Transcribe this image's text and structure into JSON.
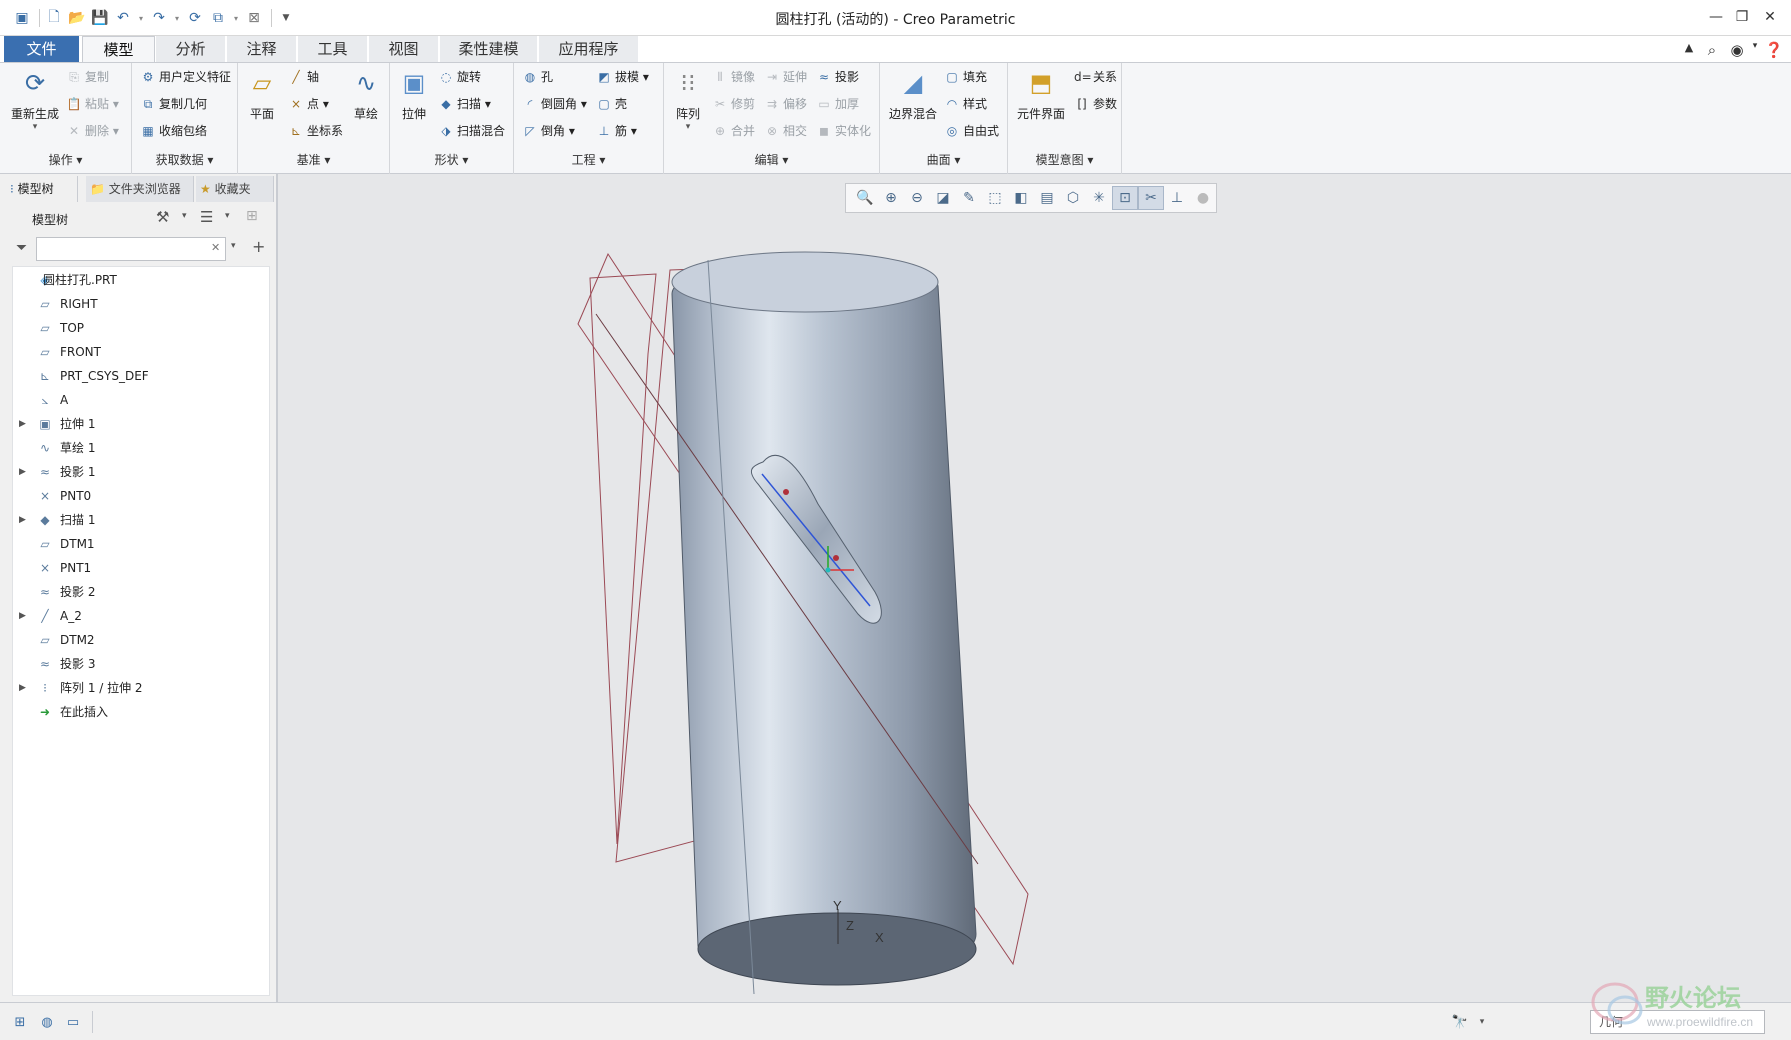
{
  "window": {
    "title": "圆柱打孔 (活动的) - Creo Parametric"
  },
  "tabs": [
    {
      "label": "文件"
    },
    {
      "label": "模型"
    },
    {
      "label": "分析"
    },
    {
      "label": "注释"
    },
    {
      "label": "工具"
    },
    {
      "label": "视图"
    },
    {
      "label": "柔性建模"
    },
    {
      "label": "应用程序"
    }
  ],
  "ribbon": {
    "operations": {
      "regen": "重新生成",
      "copy": "复制",
      "paste": "粘贴",
      "delete": "删除",
      "label": "操作"
    },
    "getdata": {
      "udf": "用户定义特征",
      "copygeom": "复制几何",
      "shrinkwrap": "收缩包络",
      "label": "获取数据"
    },
    "datum": {
      "plane": "平面",
      "axis": "轴",
      "point": "点",
      "csys": "坐标系",
      "sketch": "草绘",
      "label": "基准"
    },
    "shapes": {
      "extrude": "拉伸",
      "revolve": "旋转",
      "sweep": "扫描",
      "sweptblend": "扫描混合",
      "label": "形状"
    },
    "engineering": {
      "hole": "孔",
      "draft": "拔模",
      "round": "倒圆角",
      "shell": "壳",
      "chamfer": "倒角",
      "rib": "筋",
      "label": "工程"
    },
    "editing": {
      "pattern": "阵列",
      "mirror": "镜像",
      "extend": "延伸",
      "project": "投影",
      "trim": "修剪",
      "offset": "偏移",
      "thicken": "加厚",
      "merge": "合并",
      "intersect": "相交",
      "solidify": "实体化",
      "label": "编辑"
    },
    "surfaces": {
      "boundary": "边界混合",
      "fill": "填充",
      "style": "样式",
      "freestyle": "自由式",
      "label": "曲面"
    },
    "intent": {
      "component": "元件界面",
      "relations": "关系",
      "params": "参数",
      "label": "模型意图"
    }
  },
  "left_tabs": [
    {
      "label": "模型树"
    },
    {
      "label": "文件夹浏览器"
    },
    {
      "label": "收藏夹"
    }
  ],
  "model_tree": {
    "header": "模型树",
    "filter_value": "",
    "items": [
      {
        "label": "圆柱打孔.PRT",
        "expandable": false,
        "icon": "part-icon",
        "glyph": "◈"
      },
      {
        "label": "RIGHT",
        "expandable": false,
        "icon": "datum-plane-icon",
        "glyph": "▱"
      },
      {
        "label": "TOP",
        "expandable": false,
        "icon": "datum-plane-icon",
        "glyph": "▱"
      },
      {
        "label": "FRONT",
        "expandable": false,
        "icon": "datum-plane-icon",
        "glyph": "▱"
      },
      {
        "label": "PRT_CSYS_DEF",
        "expandable": false,
        "icon": "csys-icon",
        "glyph": "⊾"
      },
      {
        "label": "A",
        "expandable": false,
        "icon": "analysis-icon",
        "glyph": "⦣"
      },
      {
        "label": "拉伸 1",
        "expandable": true,
        "icon": "extrude-icon",
        "glyph": "▣"
      },
      {
        "label": "草绘 1",
        "expandable": false,
        "icon": "sketch-icon",
        "glyph": "∿"
      },
      {
        "label": "投影 1",
        "expandable": true,
        "icon": "project-icon",
        "glyph": "≈"
      },
      {
        "label": "PNT0",
        "expandable": false,
        "icon": "datum-point-icon",
        "glyph": "×"
      },
      {
        "label": "扫描 1",
        "expandable": true,
        "icon": "sweep-icon",
        "glyph": "◆"
      },
      {
        "label": "DTM1",
        "expandable": false,
        "icon": "datum-plane-icon",
        "glyph": "▱"
      },
      {
        "label": "PNT1",
        "expandable": false,
        "icon": "datum-point-icon",
        "glyph": "×"
      },
      {
        "label": "投影 2",
        "expandable": false,
        "icon": "project-icon",
        "glyph": "≈"
      },
      {
        "label": "A_2",
        "expandable": true,
        "icon": "datum-axis-icon",
        "glyph": "╱"
      },
      {
        "label": "DTM2",
        "expandable": false,
        "icon": "datum-plane-icon",
        "glyph": "▱"
      },
      {
        "label": "投影 3",
        "expandable": false,
        "icon": "project-icon",
        "glyph": "≈"
      },
      {
        "label": "阵列 1 / 拉伸 2",
        "expandable": true,
        "icon": "pattern-icon",
        "glyph": "⁝"
      },
      {
        "label": "在此插入",
        "expandable": false,
        "icon": "insert-here-icon",
        "glyph": "➜"
      }
    ]
  },
  "viewport": {
    "csys_labels": {
      "y": "Y",
      "z": "Z",
      "x": "X"
    }
  },
  "status": {
    "selection_filter": "几何"
  },
  "watermark": {
    "text": "野火论坛",
    "url": "www.proewildfire.cn"
  },
  "colors": {
    "accent": "#3a6fb0",
    "model": "#a9b4c4"
  }
}
